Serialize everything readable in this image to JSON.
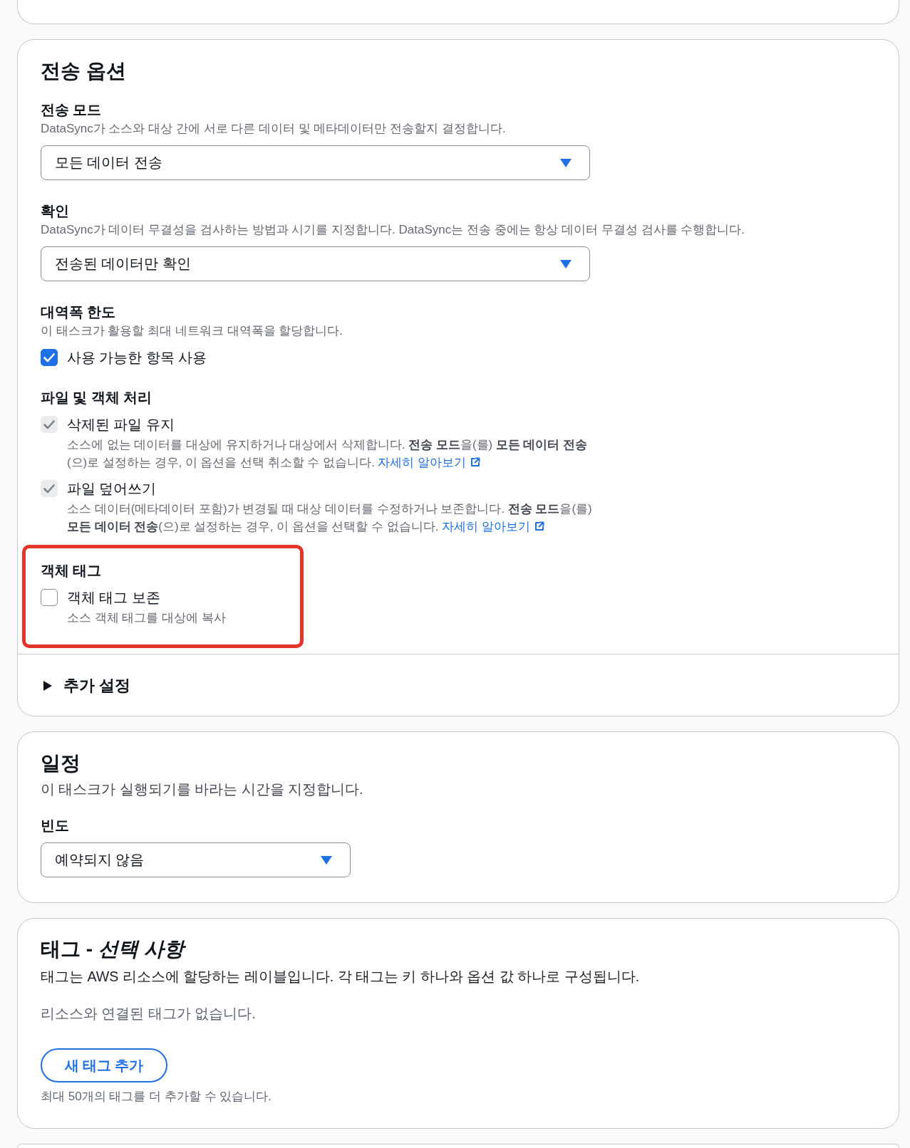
{
  "panels": [
    {
      "kind": "clipped"
    },
    {
      "kind": "form",
      "title": "전송 옵션",
      "fields": [
        {
          "kind": "select",
          "label": "전송 모드",
          "description": "DataSync가 소스와 대상 간에 서로 다른 데이터 및 메타데이터만 전송할지 결정합니다.",
          "value": "모든 데이터 전송",
          "highlighted": false
        },
        {
          "kind": "select",
          "label": "확인",
          "description": "DataSync가 데이터 무결성을 검사하는 방법과 시기를 지정합니다. DataSync는 전송 중에는 항상 데이터 무결성 검사를 수행합니다.",
          "value": "전송된 데이터만 확인",
          "highlighted": false
        },
        {
          "kind": "checkboxes",
          "label": "대역폭 한도",
          "description": "이 태스크가 활용할 최대 네트워크 대역폭을 할당합니다.",
          "options": [
            {
              "label": "사용 가능한 항목 사용",
              "checked": true,
              "disabled": false
            }
          ],
          "highlighted": false
        },
        {
          "kind": "checkboxes",
          "label": "파일 및 객체 처리",
          "options": [
            {
              "label": "삭제된 파일 유지",
              "checked": true,
              "disabled": true,
              "description": "소스에 없는 데이터를 대상에 유지하거나 대상에서 삭제합니다. **전송 모드**을(를) **모든 데이터 전송**(으)로 설정하는 경우, 이 옵션을 선택 취소할 수 없습니다.",
              "link": "자세히 알아보기"
            },
            {
              "label": "파일 덮어쓰기",
              "checked": true,
              "disabled": true,
              "description": "소스 데이터(메타데이터 포함)가 변경될 때 대상 데이터를 수정하거나 보존합니다. **전송 모드**을(를) **모든 데이터 전송**(으)로 설정하는 경우, 이 옵션을 선택할 수 없습니다.",
              "link": "자세히 알아보기"
            }
          ],
          "highlighted": false
        },
        {
          "kind": "checkboxes",
          "label": "객체 태그",
          "options": [
            {
              "label": "객체 태그 보존",
              "checked": false,
              "disabled": false,
              "description": "소스 객체 태그를 대상에 복사"
            }
          ],
          "highlighted": true
        }
      ],
      "expander": {
        "label": "추가 설정",
        "expanded": false
      }
    },
    {
      "kind": "form",
      "title": "일정",
      "description": "이 태스크가 실행되기를 바라는 시간을 지정합니다.",
      "fields": [
        {
          "kind": "select",
          "label": "빈도",
          "value": "예약되지 않음",
          "highlighted": false
        }
      ]
    },
    {
      "kind": "tags",
      "title": "태그 - *선택 사항*",
      "description": "태그는 AWS 리소스에 할당하는 레이블입니다. 각 태그는 키 하나와 옵션 값 하나로 구성됩니다.",
      "empty_message": "리소스와 연결된 태그가 없습니다.",
      "button": "새 태그 추가",
      "hint": "최대 50개의 태그를 더 추가할 수 있습니다."
    },
    {
      "kind": "clipped"
    }
  ]
}
